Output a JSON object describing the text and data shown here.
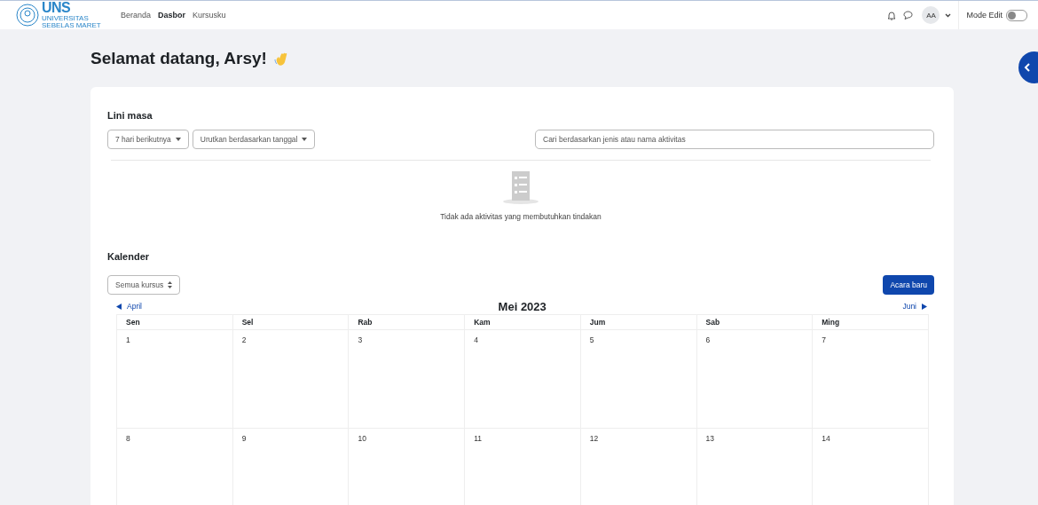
{
  "logo": {
    "abbr": "UNS",
    "line_1": "UNIVERSITAS",
    "line_2": "SEBELAS MARET"
  },
  "nav": [
    {
      "label": "Beranda",
      "selected": false
    },
    {
      "label": "Dasbor",
      "selected": true
    },
    {
      "label": "Kursusku",
      "selected": false
    }
  ],
  "user": {
    "initials": "AA"
  },
  "edit_mode": {
    "label": "Mode Edit",
    "on": false
  },
  "greeting": "Selamat datang, Arsy!",
  "timeline": {
    "title": "Lini masa",
    "filters": [
      "7 hari berikutnya",
      "Urutkan berdasarkan tanggal"
    ],
    "search": {
      "placeholder": "Cari berdasarkan jenis atau nama aktivitas"
    },
    "empty_message": "Tidak ada aktivitas yang membutuhkan tindakan"
  },
  "calendar": {
    "title": "Kalender",
    "course_filter": "Semua kursus",
    "new_event": "Acara baru",
    "prev": "April",
    "month": "Mei 2023",
    "next": "Juni",
    "weekdays": [
      "Sen",
      "Sel",
      "Rab",
      "Kam",
      "Jum",
      "Sab",
      "Ming"
    ],
    "weeks": [
      [
        "1",
        "2",
        "3",
        "4",
        "5",
        "6",
        "7"
      ],
      [
        "8",
        "9",
        "10",
        "11",
        "12",
        "13",
        "14"
      ]
    ]
  }
}
